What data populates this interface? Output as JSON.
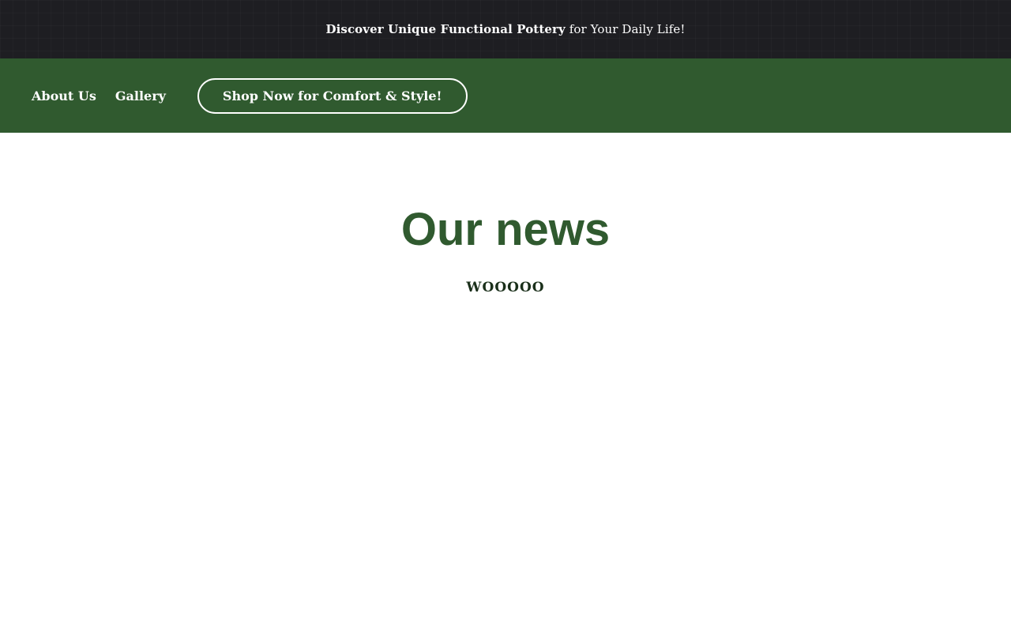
{
  "announcement": {
    "bold_text": "Discover Unique Functional Pottery",
    "rest_text": "for Your Daily Life!"
  },
  "nav": {
    "links": [
      {
        "label": "About Us"
      },
      {
        "label": "Gallery"
      }
    ],
    "cta_label": "Shop Now for Comfort & Style!"
  },
  "main": {
    "title": "Our news",
    "text": "WOOOOO"
  },
  "colors": {
    "announcement_bg": "#1e1e22",
    "nav_bg": "#305a2f",
    "title": "#305a2f",
    "text": "#1a2f1a"
  }
}
